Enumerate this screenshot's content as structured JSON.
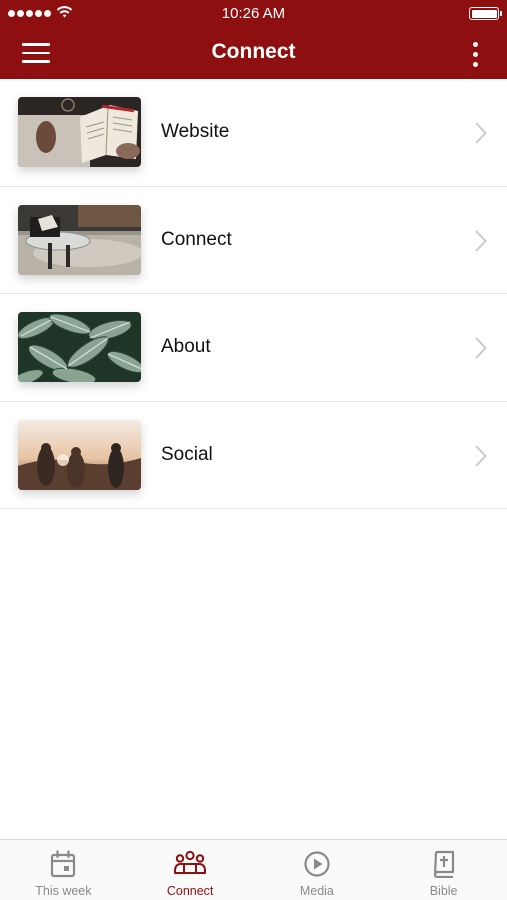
{
  "status_bar": {
    "time": "10:26 AM"
  },
  "nav": {
    "title": "Connect"
  },
  "colors": {
    "brand": "#8e0f0f",
    "tab_inactive": "#8a8a8a"
  },
  "list": {
    "items": [
      {
        "label": "Website",
        "thumbnail": "open-bible-photo"
      },
      {
        "label": "Connect",
        "thumbnail": "living-room-photo"
      },
      {
        "label": "About",
        "thumbnail": "leaves-photo"
      },
      {
        "label": "Social",
        "thumbnail": "friends-sunset-photo"
      }
    ]
  },
  "tabbar": {
    "tabs": [
      {
        "label": "This week",
        "icon": "calendar-icon",
        "active": false
      },
      {
        "label": "Connect",
        "icon": "people-icon",
        "active": true
      },
      {
        "label": "Media",
        "icon": "play-circle-icon",
        "active": false
      },
      {
        "label": "Bible",
        "icon": "bible-icon",
        "active": false
      }
    ]
  }
}
